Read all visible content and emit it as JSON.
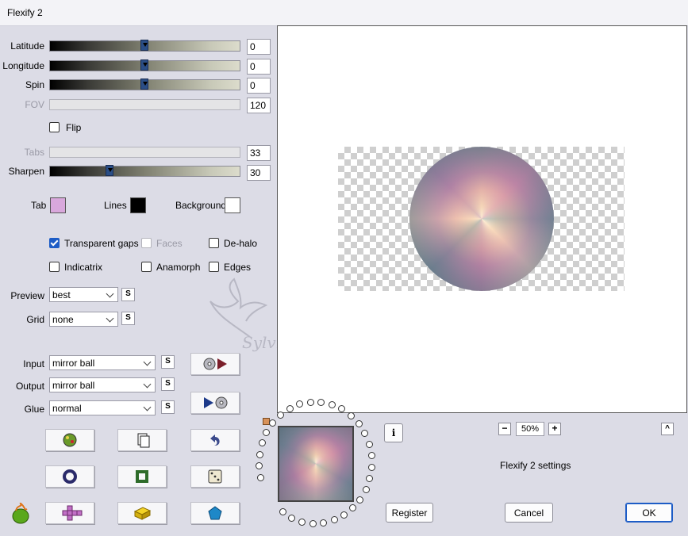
{
  "window": {
    "title": "Flexify 2"
  },
  "sliders": [
    {
      "label": "Latitude",
      "value": "0",
      "level": 0.5,
      "enabled": true
    },
    {
      "label": "Longitude",
      "value": "0",
      "level": 0.5,
      "enabled": true
    },
    {
      "label": "Spin",
      "value": "0",
      "level": 0.5,
      "enabled": true
    },
    {
      "label": "FOV",
      "value": "120",
      "level": null,
      "enabled": false
    },
    {
      "label": "Tabs",
      "value": "33",
      "level": null,
      "enabled": false
    },
    {
      "label": "Sharpen",
      "value": "30",
      "level": 0.3,
      "enabled": true
    }
  ],
  "flip_label": "Flip",
  "colors": {
    "tab_label": "Tab",
    "tab_color": "#d9a8dc",
    "lines_label": "Lines",
    "lines_color": "#000000",
    "background_label": "Background",
    "background_color": "#ffffff"
  },
  "options": {
    "transparent_gaps": "Transparent gaps",
    "faces": "Faces",
    "de_halo": "De-halo",
    "indicatrix": "Indicatrix",
    "anamorph": "Anamorph",
    "edges": "Edges"
  },
  "preview_row": {
    "label": "Preview",
    "value": "best"
  },
  "grid_row": {
    "label": "Grid",
    "value": "none"
  },
  "input_row": {
    "label": "Input",
    "value": "mirror ball"
  },
  "output_row": {
    "label": "Output",
    "value": "mirror ball"
  },
  "glue_row": {
    "label": "Glue",
    "value": "normal"
  },
  "s_button": "S",
  "watermark": "Sylviane",
  "zoom": {
    "minus": "−",
    "value": "50%",
    "plus": "+"
  },
  "caret": "^",
  "info_symbol": "i",
  "settings_name": "Flexify 2 settings",
  "buttons": {
    "register": "Register",
    "cancel": "Cancel",
    "ok": "OK"
  }
}
